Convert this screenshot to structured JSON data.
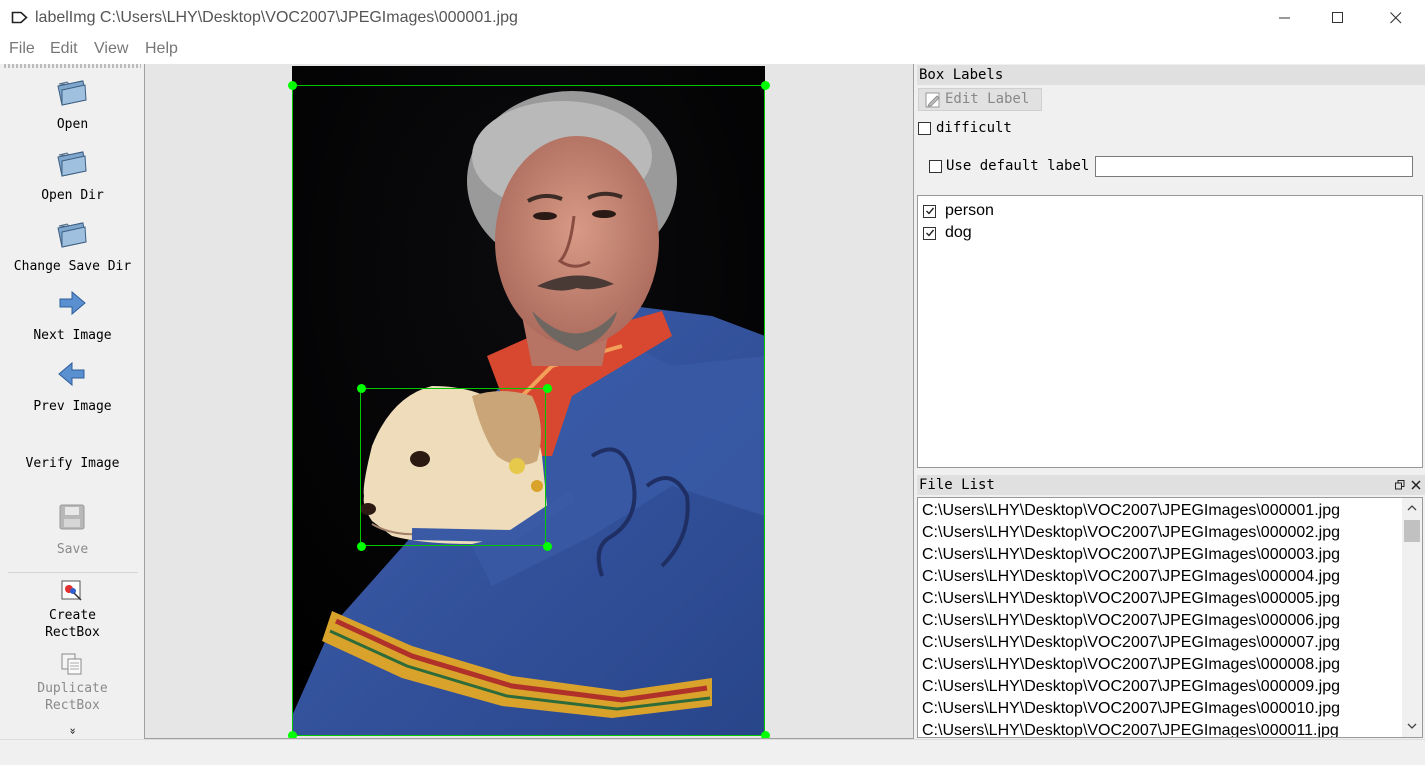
{
  "window": {
    "title": "labelImg C:\\Users\\LHY\\Desktop\\VOC2007\\JPEGImages\\000001.jpg"
  },
  "menu": [
    "File",
    "Edit",
    "View",
    "Help"
  ],
  "toolbar": {
    "open": "Open",
    "open_dir": "Open Dir",
    "change_save_dir": "Change Save Dir",
    "next_image": "Next Image",
    "prev_image": "Prev Image",
    "verify_image": "Verify Image",
    "save": "Save",
    "create_rectbox_1": "Create",
    "create_rectbox_2": "RectBox",
    "duplicate_rectbox_1": "Duplicate",
    "duplicate_rectbox_2": "RectBox",
    "more": "»"
  },
  "box_labels": {
    "title": "Box Labels",
    "edit_label": "Edit Label",
    "difficult": "difficult",
    "use_default_label": "Use default label",
    "default_label_value": "",
    "labels": [
      {
        "text": "person",
        "checked": true
      },
      {
        "text": "dog",
        "checked": true
      }
    ]
  },
  "file_list": {
    "title": "File List",
    "files": [
      "C:\\Users\\LHY\\Desktop\\VOC2007\\JPEGImages\\000001.jpg",
      "C:\\Users\\LHY\\Desktop\\VOC2007\\JPEGImages\\000002.jpg",
      "C:\\Users\\LHY\\Desktop\\VOC2007\\JPEGImages\\000003.jpg",
      "C:\\Users\\LHY\\Desktop\\VOC2007\\JPEGImages\\000004.jpg",
      "C:\\Users\\LHY\\Desktop\\VOC2007\\JPEGImages\\000005.jpg",
      "C:\\Users\\LHY\\Desktop\\VOC2007\\JPEGImages\\000006.jpg",
      "C:\\Users\\LHY\\Desktop\\VOC2007\\JPEGImages\\000007.jpg",
      "C:\\Users\\LHY\\Desktop\\VOC2007\\JPEGImages\\000008.jpg",
      "C:\\Users\\LHY\\Desktop\\VOC2007\\JPEGImages\\000009.jpg",
      "C:\\Users\\LHY\\Desktop\\VOC2007\\JPEGImages\\000010.jpg",
      "C:\\Users\\LHY\\Desktop\\VOC2007\\JPEGImages\\000011.jpg"
    ]
  },
  "colors": {
    "bbox": "#00c800",
    "handle": "#00ff00"
  }
}
